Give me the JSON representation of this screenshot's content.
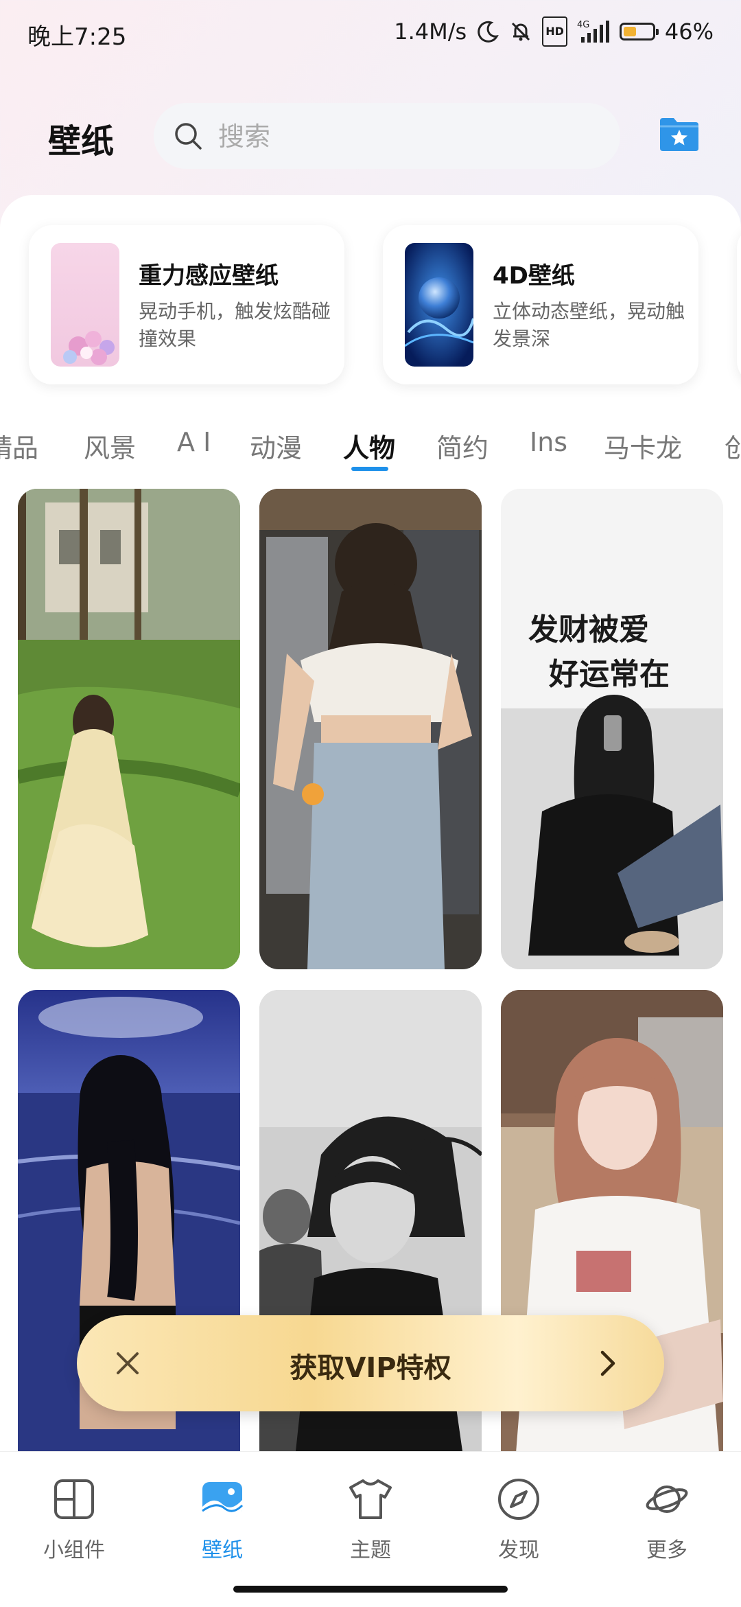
{
  "status_bar": {
    "time": "晚上7:25",
    "network_speed": "1.4M/s",
    "signal_type": "4G",
    "hd_label": "HD",
    "battery": "46%",
    "battery_level": 0.46,
    "icons": [
      "moon-icon",
      "bell-muted-icon",
      "hd-icon",
      "signal-icon",
      "battery-icon"
    ]
  },
  "header": {
    "title": "壁纸",
    "search_placeholder": "搜索",
    "favorites_icon": "star-folder-icon"
  },
  "features": [
    {
      "title": "重力感应壁纸",
      "description": "晃动手机，触发炫酷碰撞效果"
    },
    {
      "title": "4D壁纸",
      "description": "立体动态壁纸，晃动触发景深"
    }
  ],
  "categories": {
    "items": [
      "精品",
      "风景",
      "A I",
      "动漫",
      "人物",
      "简约",
      "Ins",
      "马卡龙",
      "创"
    ],
    "active": "人物"
  },
  "wallpapers": [
    {
      "subject": "girl-in-yellow-dress-garden"
    },
    {
      "subject": "girl-back-white-top-jeans"
    },
    {
      "subject": "girl-mirror-selfie-calligraphy",
      "caption_line1": "发财被爱",
      "caption_line2": "好运常在"
    },
    {
      "subject": "girl-at-sea-dusk"
    },
    {
      "subject": "black-white-portrait"
    },
    {
      "subject": "girl-pink-hair-white-tee"
    }
  ],
  "vip_banner": {
    "label": "获取VIP特权"
  },
  "bottom_nav": {
    "items": [
      {
        "label": "小组件",
        "icon": "widget-icon"
      },
      {
        "label": "壁纸",
        "icon": "wallpaper-icon"
      },
      {
        "label": "主题",
        "icon": "tshirt-icon"
      },
      {
        "label": "发现",
        "icon": "compass-icon"
      },
      {
        "label": "更多",
        "icon": "planet-icon"
      }
    ],
    "active": "壁纸"
  },
  "colors": {
    "accent": "#1e90ea",
    "vip_gold": "#f7d891",
    "battery_fill": "#f2b233"
  }
}
